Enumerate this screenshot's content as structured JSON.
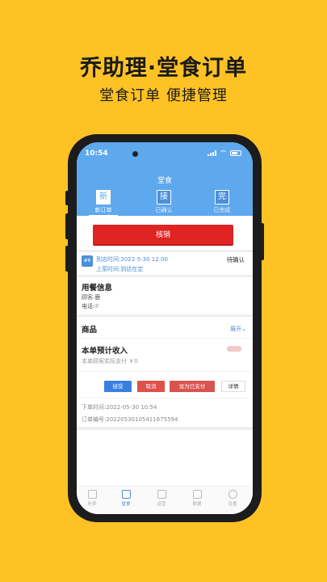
{
  "promo": {
    "title": "乔助理·堂食订单",
    "subtitle": "堂食订单  便捷管理"
  },
  "status_bar": {
    "time": "10:54"
  },
  "app": {
    "title": "堂食"
  },
  "tabs": [
    {
      "icon_char": "新",
      "label": "新订单",
      "active": true
    },
    {
      "icon_char": "接",
      "label": "已确认",
      "active": false
    },
    {
      "icon_char": "完",
      "label": "已完成",
      "active": false
    }
  ],
  "verify_button": "核销",
  "order": {
    "number": "#6",
    "arrival_time": "到店时间:2022-5-30 12:00",
    "dine_time": "上菜时间:到店在定",
    "status": "待确认",
    "dining_info_title": "用餐信息",
    "customer": "顾客:鹿",
    "phone": "电话:",
    "goods_title": "商品",
    "expand_label": "展开",
    "income_title": "本单预计收入",
    "actual_paid": "本单顾客实际支付 ￥0",
    "order_time": "下单时间:2022-05-30 10:54",
    "order_no": "订单编号:20220530105411675594"
  },
  "actions": {
    "accept": "接受",
    "cancel": "取消",
    "set_paid": "设为已支付",
    "detail": "详情"
  },
  "bottom_nav": [
    {
      "label": "外卖",
      "icon": "receipt-icon",
      "active": false
    },
    {
      "label": "堂食",
      "icon": "store-icon",
      "active": true
    },
    {
      "label": "运营",
      "icon": "chart-icon",
      "active": false
    },
    {
      "label": "数据",
      "icon": "sliders-icon",
      "active": false
    },
    {
      "label": "设置",
      "icon": "gear-icon",
      "active": false
    }
  ],
  "colors": {
    "background": "#FFC225",
    "header_blue": "#5EA8EE",
    "verify_red": "#E02424",
    "accept_blue": "#3A7FE0"
  }
}
